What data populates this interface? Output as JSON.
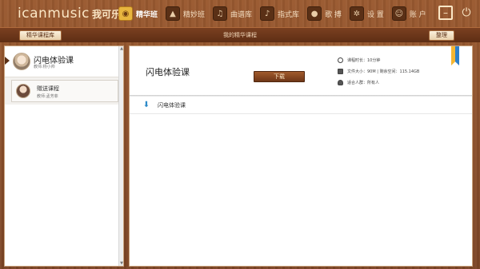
{
  "app": {
    "logo_latin": "icanmusic",
    "logo_cjk": "我可乐"
  },
  "nav": [
    {
      "label": "精华班",
      "icon": "owl-icon",
      "active": true
    },
    {
      "label": "精妙班",
      "icon": "graduation-cap-icon",
      "active": false
    },
    {
      "label": "曲谱库",
      "icon": "sheet-music-icon",
      "active": false
    },
    {
      "label": "指式库",
      "icon": "guitar-icon",
      "active": false
    },
    {
      "label": "歌 搏",
      "icon": "microphone-icon",
      "active": false
    },
    {
      "label": "设 置",
      "icon": "gear-icon",
      "active": false
    },
    {
      "label": "账 户",
      "icon": "user-icon",
      "active": false
    }
  ],
  "window": {
    "min_icon": "minimize-icon",
    "power_icon": "power-icon"
  },
  "subbar": {
    "left_button": "精华课程库",
    "title": "我的精华课程",
    "right_button": "整理"
  },
  "sidebar": {
    "courses": [
      {
        "name": "闪电体验课",
        "teacher": "教师:杨小帅"
      },
      {
        "name": "赠送课程",
        "teacher": "教师:孟芳菲"
      }
    ]
  },
  "main": {
    "title": "闪电体验课",
    "download_label": "下载",
    "info": {
      "duration": "课程时长：10分钟",
      "file_size": "文件大小：90M | 剩余空间：115.14GB",
      "audience": "适合人群：所有人"
    },
    "files": [
      {
        "name": "闪电体验课"
      }
    ]
  },
  "colors": {
    "wood_dark": "#7c4526",
    "accent_gold": "#e8b53e",
    "download_blue": "#2e8bc9"
  }
}
